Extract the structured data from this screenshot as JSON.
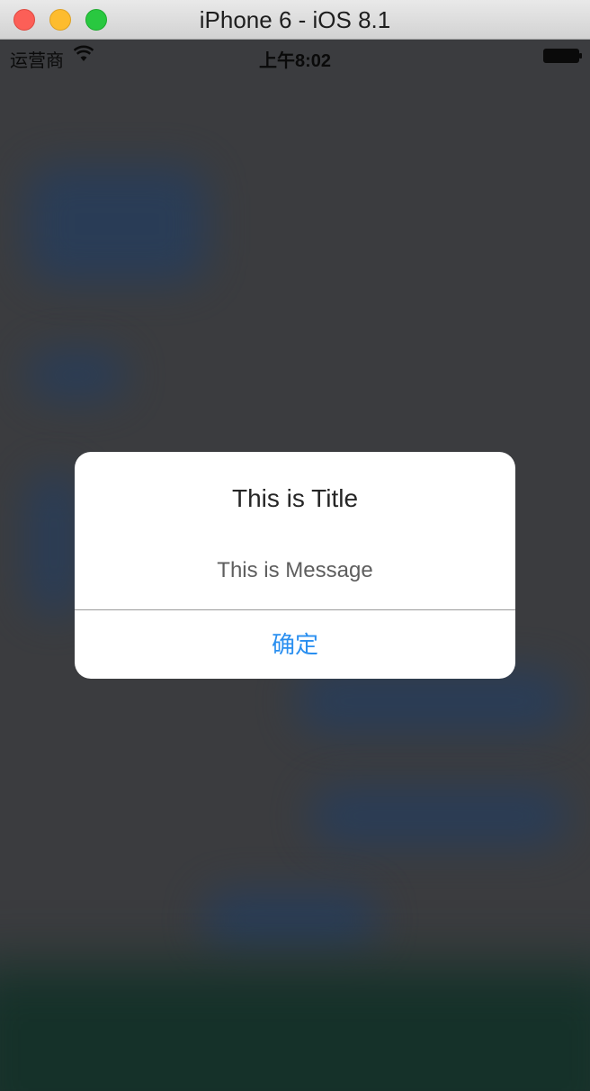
{
  "window": {
    "title": "iPhone 6 - iOS 8.1"
  },
  "status_bar": {
    "carrier": "运营商",
    "time": "上午8:02",
    "wifi_icon": "wifi-icon",
    "battery_icon": "battery-icon"
  },
  "alert": {
    "title": "This is Title",
    "message": "This is Message",
    "button_label": "确定"
  },
  "colors": {
    "accent": "#2a8ff0",
    "background": "#3b3c3f",
    "alert_background": "#ffffff"
  }
}
